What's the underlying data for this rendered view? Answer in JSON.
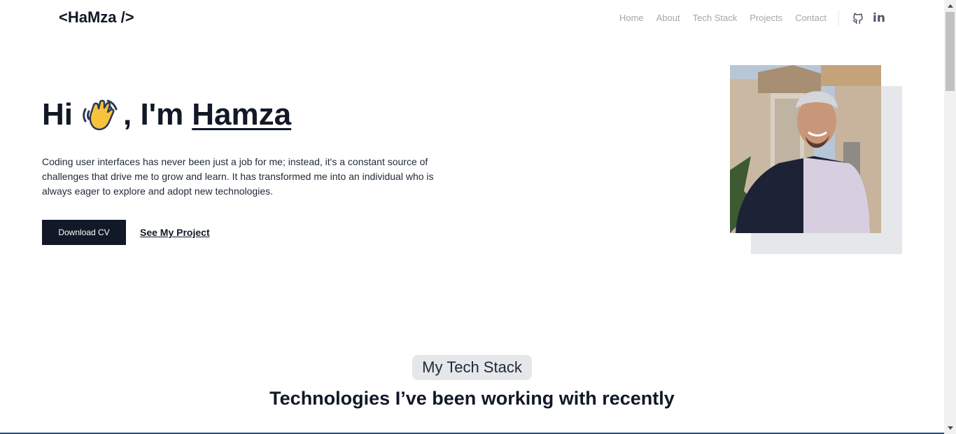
{
  "header": {
    "logo": "<HaMza />",
    "nav": [
      "Home",
      "About",
      "Tech Stack",
      "Projects",
      "Contact"
    ],
    "social": [
      {
        "icon": "github-icon"
      },
      {
        "icon": "linkedin-icon",
        "glyph": "in"
      }
    ]
  },
  "hero": {
    "greeting_prefix": "Hi",
    "greeting_mid": ", I'm",
    "name": "Hamza",
    "emoji": "waving-hand-icon",
    "description": "Coding user interfaces has never been just a job for me; instead, it's a constant source of challenges that drive me to grow and learn. It has transformed me into an individual who is always eager to explore and adopt new technologies.",
    "cta_primary": "Download CV",
    "cta_secondary": "See My Project"
  },
  "tech": {
    "badge": "My Tech Stack",
    "heading": "Technologies I’ve been working with recently"
  },
  "colors": {
    "primary": "#111827",
    "nav_text": "#a3a7ae",
    "photo_shadow": "#e5e7eb",
    "pill_bg": "#e5e7eb"
  }
}
